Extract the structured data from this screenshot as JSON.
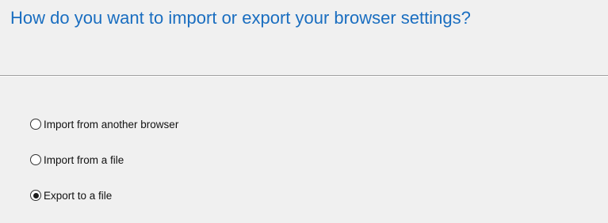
{
  "dialog": {
    "title": "How do you want to import or export your browser settings?"
  },
  "options": [
    {
      "label": "Import from another browser",
      "checked": false
    },
    {
      "label": "Import from a file",
      "checked": false
    },
    {
      "label": "Export to a file",
      "checked": true
    }
  ],
  "colors": {
    "title": "#1a6ec0",
    "background": "#f0f0f0",
    "divider": "#a0a0a0"
  },
  "icons": {
    "radio_unchecked": "radio-unchecked-icon",
    "radio_checked": "radio-checked-icon"
  }
}
